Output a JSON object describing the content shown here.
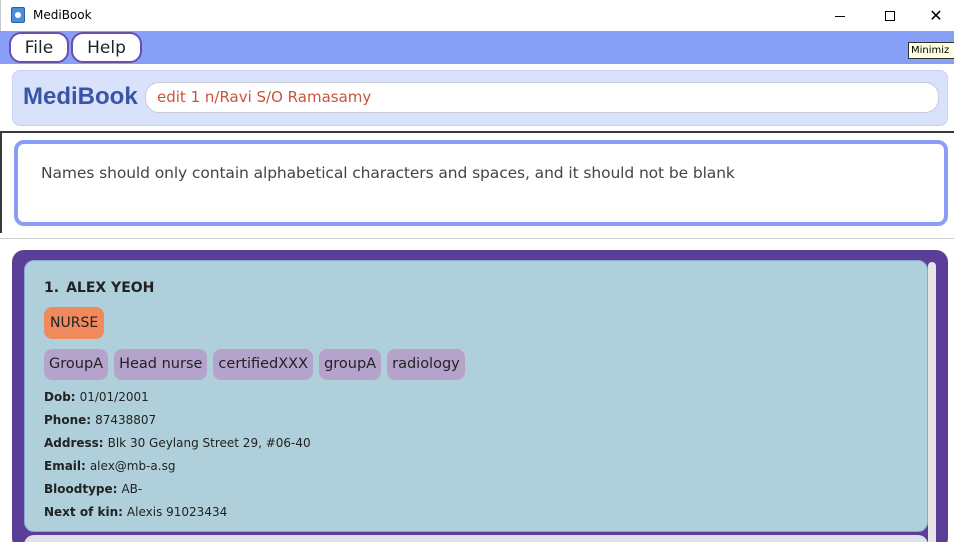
{
  "window": {
    "title": "MediBook",
    "close_glyph": "✕"
  },
  "menu": {
    "file_label": "File",
    "help_label": "Help",
    "tooltip": "Minimiz"
  },
  "header": {
    "brand": "MediBook",
    "command_value": "edit 1 n/Ravi S/O Ramasamy"
  },
  "result": {
    "message": "Names should only contain alphabetical characters and spaces, and it should not be blank"
  },
  "person": {
    "index": "1.",
    "name": "ALEX YEOH",
    "role": "NURSE",
    "tags": [
      "GroupA",
      "Head nurse",
      "certifiedXXX",
      "groupA",
      "radiology"
    ],
    "fields": [
      {
        "label": "Dob:",
        "value": "01/01/2001"
      },
      {
        "label": "Phone:",
        "value": "87438807"
      },
      {
        "label": "Address:",
        "value": "Blk 30 Geylang Street 29, #06-40"
      },
      {
        "label": "Email:",
        "value": "alex@mb-a.sg"
      },
      {
        "label": "Bloodtype:",
        "value": "AB-"
      },
      {
        "label": "Next of kin:",
        "value": "Alexis 91023434"
      }
    ]
  },
  "colors": {
    "menubar": "#889ff7",
    "brand": "#3a55a8",
    "command_text": "#c9543c",
    "list_panel": "#5b3e98",
    "card": "#afd0da",
    "role_badge": "#f08a5d",
    "tag": "#b6a3cc"
  }
}
